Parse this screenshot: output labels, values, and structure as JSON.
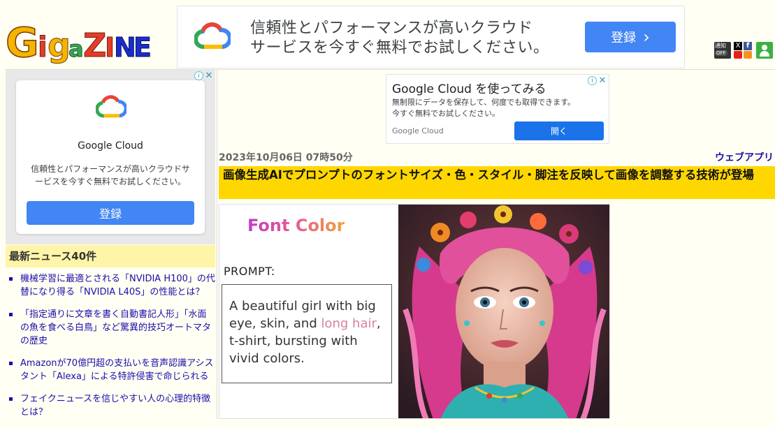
{
  "site": {
    "logo_text": "GigaZINE"
  },
  "top_ad": {
    "text_line1": "信頼性とパフォーマンスが高いクラウド",
    "text_line2": "サービスを今すぐ無料でお試しください。",
    "button_label": "登録",
    "button_arrow": "›",
    "adchoice": "i",
    "close": "✕"
  },
  "header_icons": {
    "notify_label": "通知",
    "notify_state": "OFF",
    "x_label": "X",
    "facebook_label": "f"
  },
  "sidebar_ad": {
    "brand": "Google Cloud",
    "desc": "信頼性とパフォーマンスが高いクラウドサービスを今すぐ無料でお試しください。",
    "button_label": "登録",
    "adchoice": "i",
    "close": "✕"
  },
  "news": {
    "heading": "最新ニュース40件",
    "items": [
      "機械学習に最適とされる「NVIDIA H100」の代替になり得る「NVIDIA L40S」の性能とは？",
      "「指定通りに文章を書く自動書記人形」「水面の魚を食べる白鳥」など驚異的技巧オートマタの歴史",
      "Amazonが70億円超の支払いを音声認識アシスタント「Alexa」による特許侵害で命じられる",
      "フェイクニュースを信じやすい人の心理的特徴とは？"
    ]
  },
  "mid_ad": {
    "title": "Google Cloud を使ってみる",
    "desc_line1": "無制限にデータを保存して、何度でも取得できます。",
    "desc_line2": "今すぐ無料でお試しください。",
    "brand": "Google Cloud",
    "button_label": "開く",
    "adchoice": "i",
    "close": "✕"
  },
  "article": {
    "date": "2023年10月06日 07時50分",
    "category": "ウェブアプリ",
    "title": "画像生成AIでプロンプトのフォントサイズ・色・スタイル・脚注を反映して画像を調整する技術が登場"
  },
  "figure": {
    "heading": "Font Color",
    "prompt_label": "PROMPT:",
    "prompt_pre": "A beautiful girl with big eye, skin, and ",
    "prompt_highlight": "long hair",
    "prompt_post": ", t-shirt, bursting with vivid colors."
  },
  "colors": {
    "brand_blue": "#4285f4",
    "title_bar": "#ffd700",
    "news_head": "#fff5a8",
    "link": "#1a0dab",
    "highlight": "#d9829a"
  }
}
